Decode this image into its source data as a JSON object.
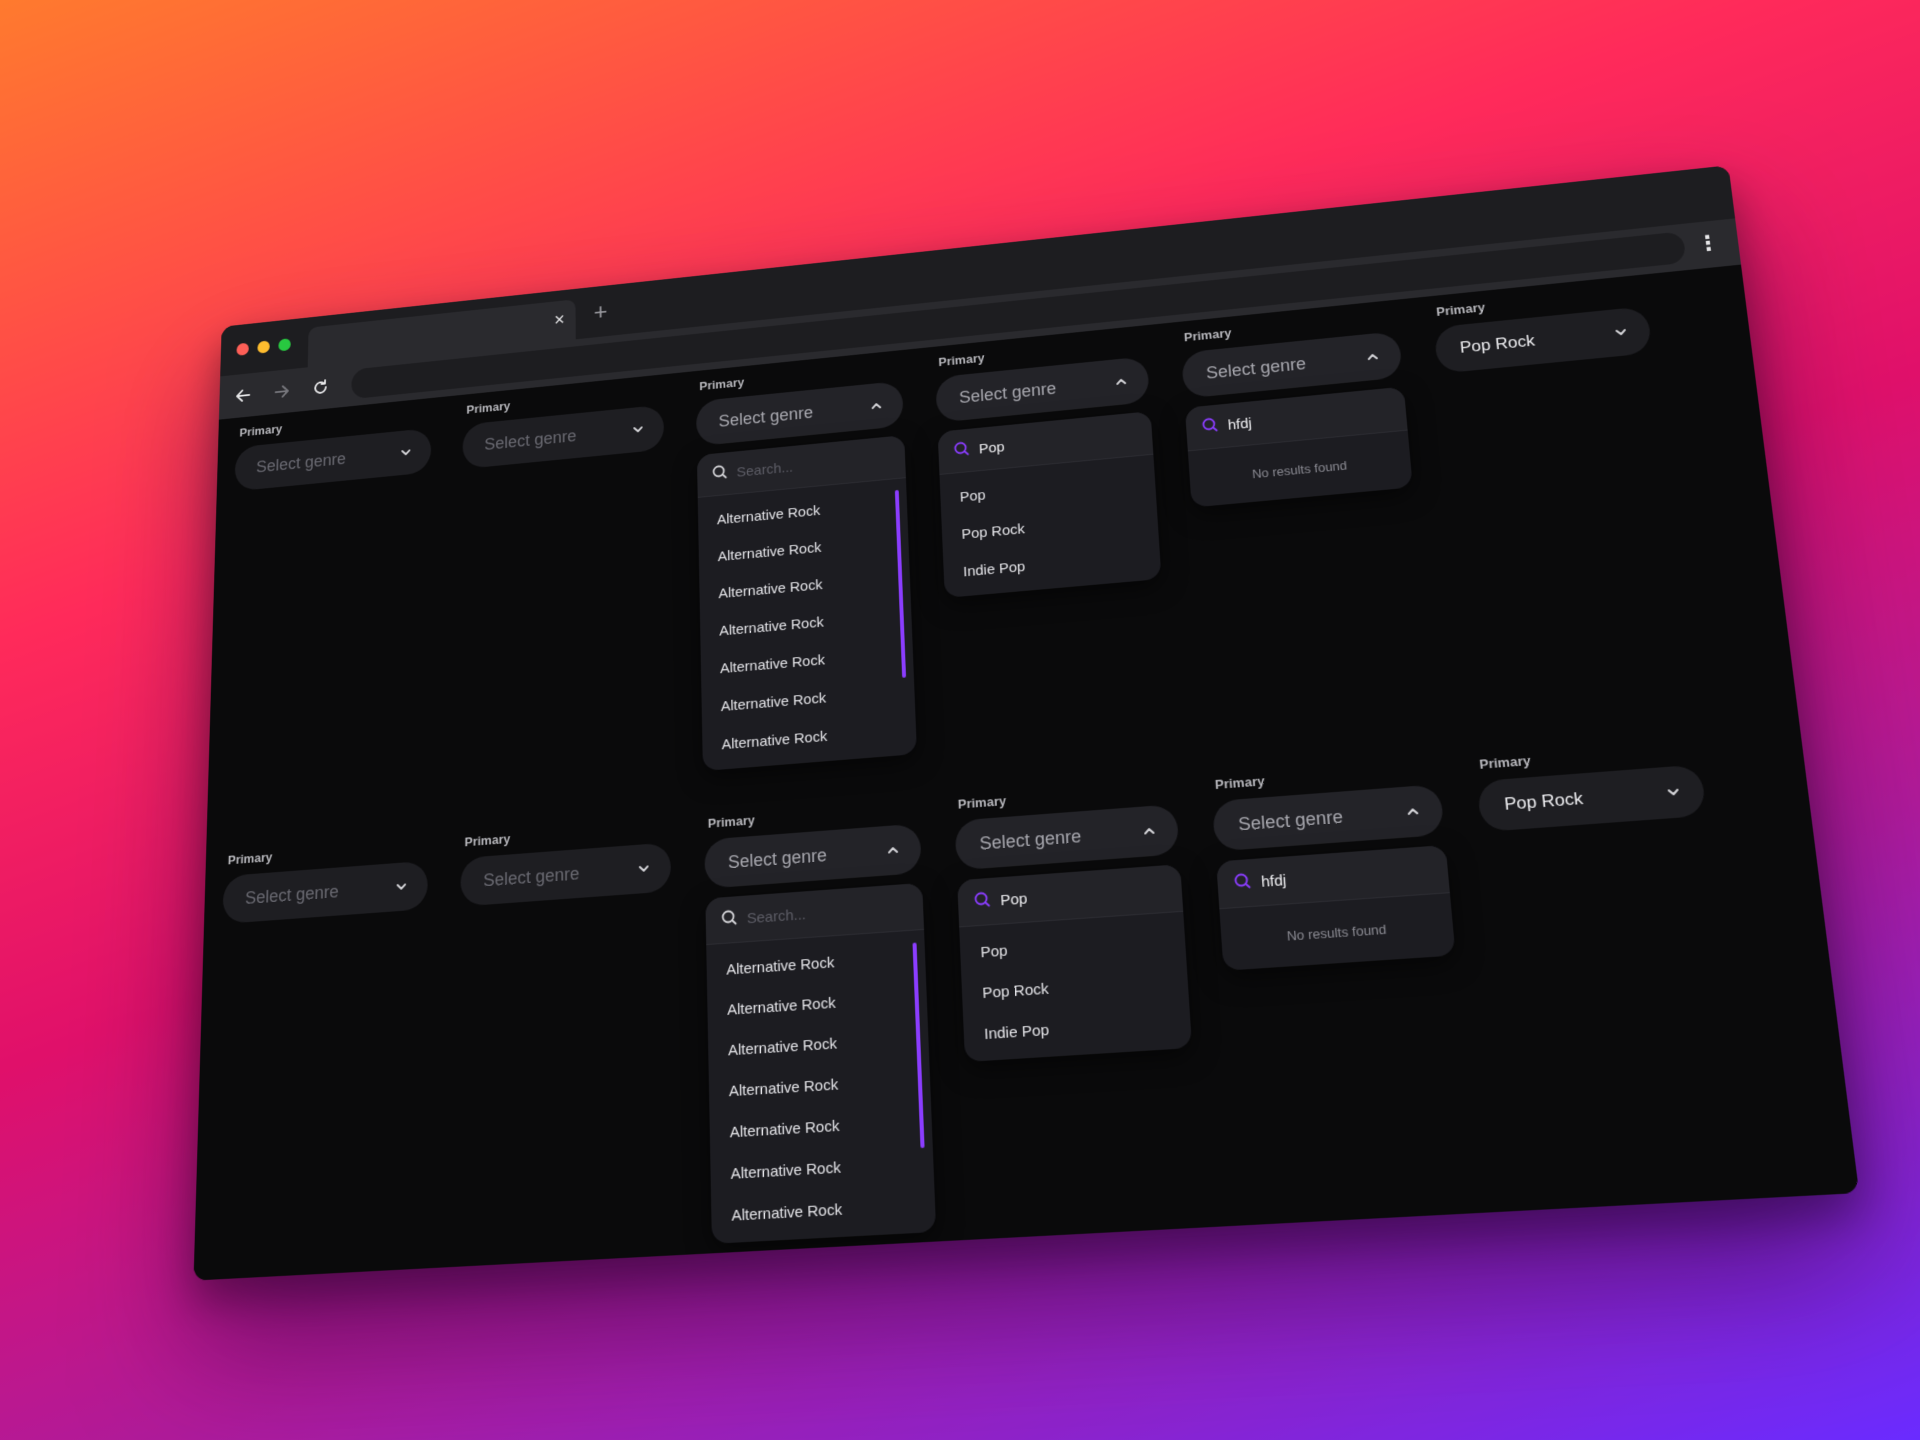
{
  "browser": {
    "tab_close": "×",
    "tab_new": "+",
    "menu": "⋮"
  },
  "colors": {
    "accent": "#8b3dff",
    "background": "#0a0a0b",
    "control": "#1e1e22"
  },
  "icons": {
    "back": "arrow-left-icon",
    "forward": "arrow-right-icon",
    "reload": "reload-icon",
    "search": "search-icon",
    "chevron_down": "chevron-down-icon",
    "chevron_up": "chevron-up-icon",
    "clear": "close-icon"
  },
  "rows": [
    {
      "variants": [
        {
          "label": "Primary",
          "value": "Select genre"
        },
        {
          "label": "Primary",
          "value": "Select genre"
        },
        {
          "label": "Primary",
          "value": "Select genre",
          "search_placeholder": "Search...",
          "options": [
            "Alternative Rock",
            "Alternative Rock",
            "Alternative Rock",
            "Alternative Rock",
            "Alternative Rock",
            "Alternative Rock",
            "Alternative Rock"
          ]
        },
        {
          "label": "Primary",
          "value": "Select genre",
          "query": "Pop",
          "options": [
            "Pop",
            "Pop Rock",
            "Indie Pop"
          ]
        },
        {
          "label": "Primary",
          "value": "Select genre",
          "query": "hfdj",
          "empty": "No results found"
        },
        {
          "label": "Primary",
          "value": "Pop Rock"
        }
      ]
    },
    {
      "variants": [
        {
          "label": "Primary",
          "value": "Select genre"
        },
        {
          "label": "Primary",
          "value": "Select genre"
        },
        {
          "label": "Primary",
          "value": "Select genre",
          "search_placeholder": "Search...",
          "options": [
            "Alternative Rock",
            "Alternative Rock",
            "Alternative Rock",
            "Alternative Rock",
            "Alternative Rock",
            "Alternative Rock",
            "Alternative Rock"
          ]
        },
        {
          "label": "Primary",
          "value": "Select genre",
          "query": "Pop",
          "options": [
            "Pop",
            "Pop Rock",
            "Indie Pop"
          ]
        },
        {
          "label": "Primary",
          "value": "Select genre",
          "query": "hfdj",
          "empty": "No results found"
        },
        {
          "label": "Primary",
          "value": "Pop Rock"
        }
      ]
    }
  ]
}
